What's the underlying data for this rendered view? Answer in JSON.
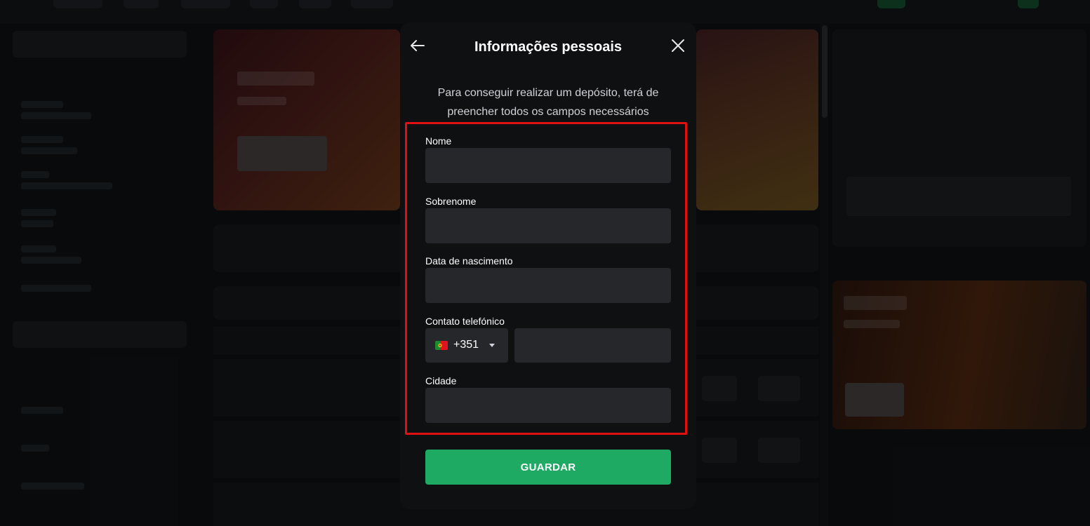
{
  "modal": {
    "title": "Informações pessoais",
    "description": "Para conseguir realizar um depósito, terá de preencher todos os campos necessários",
    "fields": [
      {
        "label": "Nome",
        "value": "",
        "placeholder": ""
      },
      {
        "label": "Sobrenome",
        "value": "",
        "placeholder": ""
      },
      {
        "label": "Data de nascimento",
        "value": "",
        "placeholder": ""
      },
      {
        "label": "Contato telefónico",
        "value": "",
        "placeholder": ""
      },
      {
        "label": "Cidade",
        "value": "",
        "placeholder": ""
      }
    ],
    "phone": {
      "country_code": "+351",
      "country_flag": "portugal-flag-icon",
      "number": ""
    },
    "save_label": "GUARDAR",
    "icons": {
      "back": "arrow-left-icon",
      "close": "close-icon",
      "dropdown": "caret-down-icon"
    }
  },
  "colors": {
    "modal_bg": "#0f1012",
    "input_bg": "#25272b",
    "accent_green": "#1faa63",
    "highlight_red": "#e10f12"
  }
}
